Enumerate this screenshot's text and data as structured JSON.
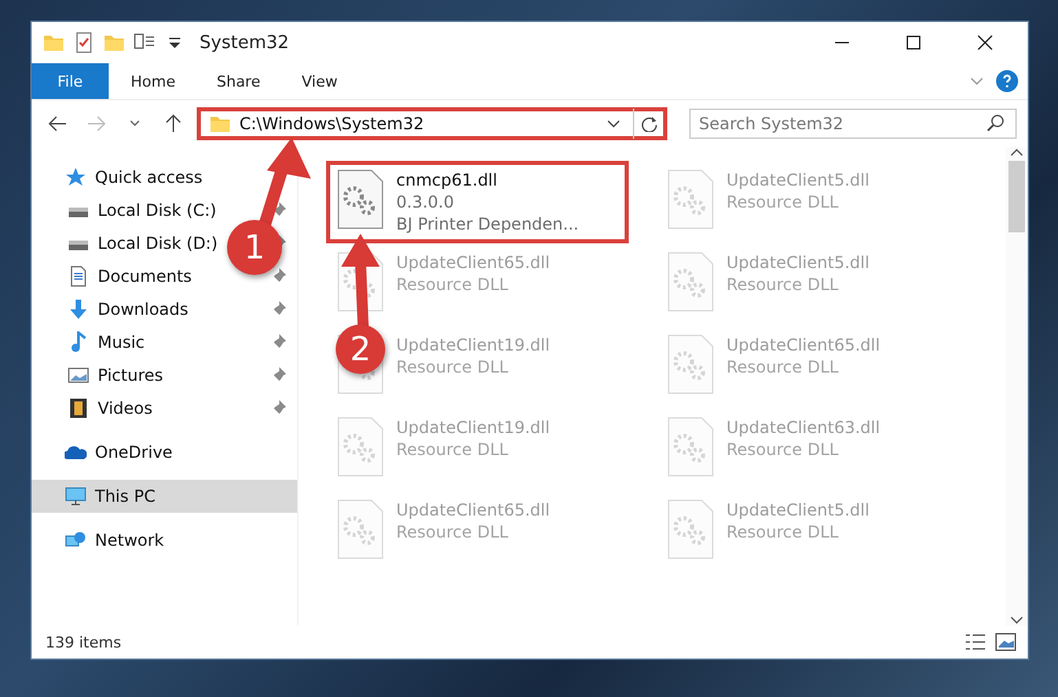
{
  "window": {
    "title": "System32"
  },
  "ribbon": {
    "file_tab": "File",
    "tabs": [
      "Home",
      "Share",
      "View"
    ]
  },
  "address_bar": {
    "path": "C:\\Windows\\System32",
    "highlighted": true
  },
  "search": {
    "placeholder": "Search System32"
  },
  "sidebar": {
    "items": [
      {
        "label": "Quick access",
        "selected": false,
        "children": [
          {
            "label": "Local Disk (C:)",
            "pinned": true
          },
          {
            "label": "Local Disk (D:)",
            "pinned": true
          },
          {
            "label": "Documents",
            "pinned": true
          },
          {
            "label": "Downloads",
            "pinned": true
          },
          {
            "label": "Music",
            "pinned": true
          },
          {
            "label": "Pictures",
            "pinned": true
          },
          {
            "label": "Videos",
            "pinned": true
          }
        ]
      },
      {
        "label": "OneDrive",
        "selected": false
      },
      {
        "label": "This PC",
        "selected": true
      },
      {
        "label": "Network",
        "selected": false
      }
    ]
  },
  "files": [
    {
      "name": "cnmcp61.dll",
      "version": "0.3.0.0",
      "description": "BJ Printer Dependen...",
      "highlighted": true,
      "faded": false
    },
    {
      "name": "UpdateClient5.dll",
      "description": "Resource DLL",
      "highlighted": false,
      "faded": true
    },
    {
      "name": "UpdateClient65.dll",
      "description": "Resource DLL",
      "highlighted": false,
      "faded": true
    },
    {
      "name": "UpdateClient5.dll",
      "description": "Resource DLL",
      "highlighted": false,
      "faded": true
    },
    {
      "name": "UpdateClient19.dll",
      "description": "Resource DLL",
      "highlighted": false,
      "faded": true
    },
    {
      "name": "UpdateClient65.dll",
      "description": "Resource DLL",
      "highlighted": false,
      "faded": true
    },
    {
      "name": "UpdateClient19.dll",
      "description": "Resource DLL",
      "highlighted": false,
      "faded": true
    },
    {
      "name": "UpdateClient63.dll",
      "description": "Resource DLL",
      "highlighted": false,
      "faded": true
    },
    {
      "name": "UpdateClient65.dll",
      "description": "Resource DLL",
      "highlighted": false,
      "faded": true
    },
    {
      "name": "UpdateClient5.dll",
      "description": "Resource DLL",
      "highlighted": false,
      "faded": true
    }
  ],
  "status_bar": {
    "count": "139 items"
  },
  "annotations": [
    {
      "number": "1"
    },
    {
      "number": "2"
    }
  ]
}
